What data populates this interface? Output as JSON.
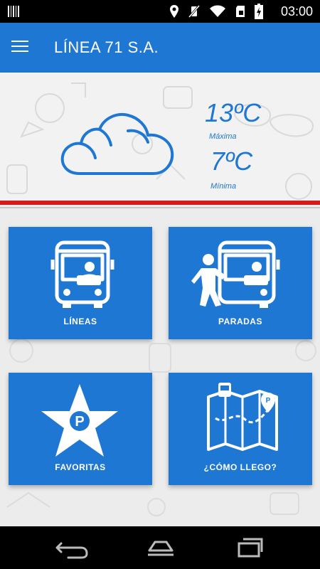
{
  "status_bar": {
    "time": "03:00",
    "icons": [
      "barcode-icon",
      "location-icon",
      "mute-icon",
      "wifi-icon",
      "sd-card-icon",
      "battery-charging-icon"
    ]
  },
  "app_bar": {
    "title": "LÍNEA 71 S.A.",
    "menu_icon": "menu-icon"
  },
  "weather": {
    "icon": "cloud-icon",
    "max_temp": "13ºC",
    "max_label": "Máxima",
    "min_temp": "7ºC",
    "min_label": "Mínima"
  },
  "tiles": [
    {
      "label": "LÍNEAS",
      "icon": "bus-icon"
    },
    {
      "label": "PARADAS",
      "icon": "bus-stop-icon"
    },
    {
      "label": "FAVORITAS",
      "icon": "favorite-star-icon"
    },
    {
      "label": "¿CÓMO LLEGO?",
      "icon": "map-route-icon"
    }
  ],
  "nav_bar": [
    "back-icon",
    "home-icon",
    "recents-icon"
  ],
  "colors": {
    "primary": "#1f77d4",
    "accent_red": "#d31b1b",
    "background": "#ececec"
  }
}
